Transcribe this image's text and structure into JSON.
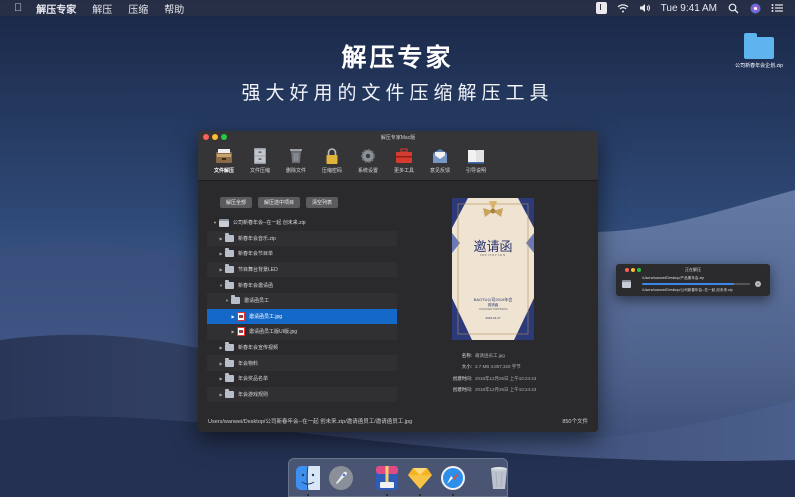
{
  "menubar": {
    "app_name": "解压专家",
    "menus": [
      "解压",
      "压缩",
      "帮助"
    ],
    "clock": "Tue 9:41 AM"
  },
  "promo": {
    "headline": "解压专家",
    "subline": "强大好用的文件压缩解压工具"
  },
  "desktop_file": {
    "name": "公司新春年会企划.zip"
  },
  "window": {
    "title": "解压专家Mac版",
    "toolbar": [
      {
        "label": "文件解压",
        "icon": "drawer-icon"
      },
      {
        "label": "文件压缩",
        "icon": "cabinet-icon"
      },
      {
        "label": "删除文件",
        "icon": "trash-icon"
      },
      {
        "label": "压缩密码",
        "icon": "lock-icon"
      },
      {
        "label": "系统设置",
        "icon": "gear-icon"
      },
      {
        "label": "更多工具",
        "icon": "toolbox-icon"
      },
      {
        "label": "意见反馈",
        "icon": "feedback-icon"
      },
      {
        "label": "引导说明",
        "icon": "book-icon"
      }
    ],
    "buttons": [
      "解压全部",
      "解压选中项目",
      "清空列表"
    ],
    "tree": [
      {
        "label": "公司新春年会--在一起 创未来.zip",
        "kind": "zip",
        "depth": 0,
        "arrow": "▼"
      },
      {
        "label": "新春年会音乐.zip",
        "kind": "folder",
        "depth": 1,
        "arrow": "▶"
      },
      {
        "label": "新春年会节目单",
        "kind": "folder",
        "depth": 1,
        "arrow": "▶"
      },
      {
        "label": "节目舞台背景LED",
        "kind": "folder",
        "depth": 1,
        "arrow": "▶"
      },
      {
        "label": "新春年会邀请函",
        "kind": "folder",
        "depth": 1,
        "arrow": "▼"
      },
      {
        "label": "邀请函员工",
        "kind": "folder",
        "depth": 2,
        "arrow": "▼"
      },
      {
        "label": "邀请函员工.jpg",
        "kind": "image",
        "depth": 3,
        "arrow": "▶"
      },
      {
        "label": "邀请函员工版UI版.jpg",
        "kind": "image",
        "depth": 3,
        "arrow": "▶"
      },
      {
        "label": "新春年会宣传视频",
        "kind": "folder",
        "depth": 1,
        "arrow": "▶"
      },
      {
        "label": "年会物料",
        "kind": "folder",
        "depth": 1,
        "arrow": "▶"
      },
      {
        "label": "年会奖品名单",
        "kind": "folder",
        "depth": 1,
        "arrow": "▶"
      },
      {
        "label": "年会游戏规则",
        "kind": "folder",
        "depth": 1,
        "arrow": "▶"
      }
    ],
    "selected_index": 6,
    "preview": {
      "card_title": "邀请函",
      "card_sub": "INVITATION",
      "card_event": "BAOTU公司2019年会",
      "card_line2": "邀请函",
      "card_line3": "YOUR NEW HAPPINESS",
      "card_date": "2019.01.27"
    },
    "info": [
      {
        "k": "名称:",
        "v": "邀请函员工.jpg"
      },
      {
        "k": "大小:",
        "v": "3.7 MB 3,857,320 字节"
      },
      {
        "k": "创建时间:",
        "v": "2018年12月26日 上午10:24:43"
      },
      {
        "k": "创建时间:",
        "v": "2018年12月26日 上午10:24:43"
      }
    ],
    "footer_path": "Users/wanwei/Desktop/公司新春年会--在一起 创未来.zip/邀请函员工/邀请函员工.jpg",
    "footer_count": "850个文件"
  },
  "popup": {
    "title": "正在解压",
    "path1": "/Users/wanwei/Desktop/产品素年会.zip",
    "path2": "/Users/wanwei/Desktop/公司新春年会--在一起 创未来.zip",
    "progress": 0.85
  },
  "colors": {
    "accent": "#1468c8",
    "window_bg": "#2a2a2c",
    "progress": "#3a89e8"
  }
}
